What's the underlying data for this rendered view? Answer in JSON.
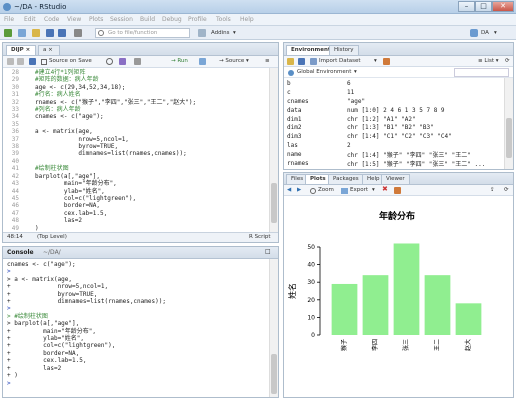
{
  "window": {
    "title": "~/DA - RStudio",
    "minimize": "–",
    "maximize": "□",
    "close": "✕"
  },
  "menu": [
    "File",
    "Edit",
    "Code",
    "View",
    "Plots",
    "Session",
    "Build",
    "Debug",
    "Profile",
    "Tools",
    "Help"
  ],
  "toolbar": {
    "goto_placeholder": "Go to file/function",
    "addins": "Addins",
    "project": "DA"
  },
  "editor": {
    "tabs": [
      "DIJP",
      "a"
    ],
    "source_on_save": "Source on Save",
    "run": "Run",
    "source": "Source",
    "status_pos": "48:14",
    "status_level": "(Top Level)",
    "status_type": "R Script",
    "line_numbers": [
      "28",
      "29",
      "30",
      "31",
      "32",
      "33",
      "34",
      "35",
      "36",
      "37",
      "38",
      "39",
      "40",
      "41",
      "42",
      "43",
      "44",
      "45",
      "46",
      "47",
      "48",
      "49"
    ],
    "lines": [
      {
        "cls": "cmt",
        "text": "#建立4行*1列矩阵"
      },
      {
        "cls": "cmt",
        "text": "#矩阵的数据：病人年龄"
      },
      {
        "cls": "",
        "text": "age <- c(29,34,52,34,18);"
      },
      {
        "cls": "cmt",
        "text": "#行名：病人姓名"
      },
      {
        "cls": "",
        "text": "rnames <- c(\"猴子\",\"李四\",\"张三\",\"王二\",\"赵大\");"
      },
      {
        "cls": "cmt",
        "text": "#列名：病人年龄"
      },
      {
        "cls": "",
        "text": "cnames <- c(\"age\");"
      },
      {
        "cls": "",
        "text": ""
      },
      {
        "cls": "",
        "text": "a <- matrix(age,"
      },
      {
        "cls": "",
        "text": "            nrow=5,ncol=1,"
      },
      {
        "cls": "",
        "text": "            byrow=TRUE,"
      },
      {
        "cls": "",
        "text": "            dimnames=list(rnames,cnames));"
      },
      {
        "cls": "",
        "text": ""
      },
      {
        "cls": "cmt",
        "text": "#绘制柱状图"
      },
      {
        "cls": "",
        "text": "barplot(a[,\"age\"],"
      },
      {
        "cls": "",
        "text": "        main=\"年龄分布\","
      },
      {
        "cls": "",
        "text": "        ylab=\"姓名\","
      },
      {
        "cls": "",
        "text": "        col=c(\"lightgreen\"),"
      },
      {
        "cls": "",
        "text": "        border=NA,"
      },
      {
        "cls": "",
        "text": "        cex.lab=1.5,"
      },
      {
        "cls": "",
        "text": "        las=2"
      },
      {
        "cls": "",
        "text": ")"
      }
    ]
  },
  "console": {
    "tab": "Console",
    "path": "~/DA/",
    "lines": [
      {
        "cls": "",
        "text": "cnames <- c(\"age\");"
      },
      {
        "cls": "prompt",
        "text": ">"
      },
      {
        "cls": "",
        "text": "> a <- matrix(age,"
      },
      {
        "cls": "",
        "text": "+             nrow=5,ncol=1,"
      },
      {
        "cls": "",
        "text": "+             byrow=TRUE,"
      },
      {
        "cls": "",
        "text": "+             dimnames=list(rnames,cnames));"
      },
      {
        "cls": "prompt",
        "text": ">"
      },
      {
        "cls": "cmt",
        "text": "> #绘制柱状图"
      },
      {
        "cls": "",
        "text": "> barplot(a[,\"age\"],"
      },
      {
        "cls": "",
        "text": "+         main=\"年龄分布\","
      },
      {
        "cls": "",
        "text": "+         ylab=\"姓名\","
      },
      {
        "cls": "",
        "text": "+         col=c(\"lightgreen\"),"
      },
      {
        "cls": "",
        "text": "+         border=NA,"
      },
      {
        "cls": "",
        "text": "+         cex.lab=1.5,"
      },
      {
        "cls": "",
        "text": "+         las=2"
      },
      {
        "cls": "",
        "text": "+ )"
      },
      {
        "cls": "prompt",
        "text": ">"
      }
    ]
  },
  "environment": {
    "tabs": [
      "Environment",
      "History"
    ],
    "import": "Import Dataset",
    "list": "List",
    "scope": "Global Environment",
    "rows": [
      {
        "name": "b",
        "value": "6"
      },
      {
        "name": "c",
        "value": "11"
      },
      {
        "name": "cnames",
        "value": "\"age\""
      },
      {
        "name": "data",
        "value": "num [1:0] 2 4 6 1 3 5 7 8 9"
      },
      {
        "name": "dim1",
        "value": "chr [1:2] \"A1\" \"A2\""
      },
      {
        "name": "dim2",
        "value": "chr [1:3] \"B1\" \"B2\" \"B3\""
      },
      {
        "name": "dim3",
        "value": "chr [1:4] \"C1\" \"C2\" \"C3\" \"C4\""
      },
      {
        "name": "las",
        "value": "2"
      },
      {
        "name": "name",
        "value": "chr [1:4] \"猴子\" \"李四\" \"张三\" \"王二\""
      },
      {
        "name": "rnames",
        "value": "chr [1:5] \"猴子\" \"李四\" \"张三\" \"王二\" ..."
      }
    ]
  },
  "plots": {
    "tabs": [
      "Files",
      "Plots",
      "Packages",
      "Help",
      "Viewer"
    ],
    "zoom": "Zoom",
    "export": "Export"
  },
  "chart_data": {
    "type": "bar",
    "title": "年龄分布",
    "ylabel": "姓名",
    "xlabel": "",
    "categories": [
      "猴子",
      "李四",
      "张三",
      "王二",
      "赵大"
    ],
    "values": [
      29,
      34,
      52,
      34,
      18
    ],
    "ylim": [
      0,
      50
    ],
    "yticks": [
      "0",
      "10",
      "20",
      "30",
      "40",
      "50"
    ],
    "color": "#90ee90"
  }
}
